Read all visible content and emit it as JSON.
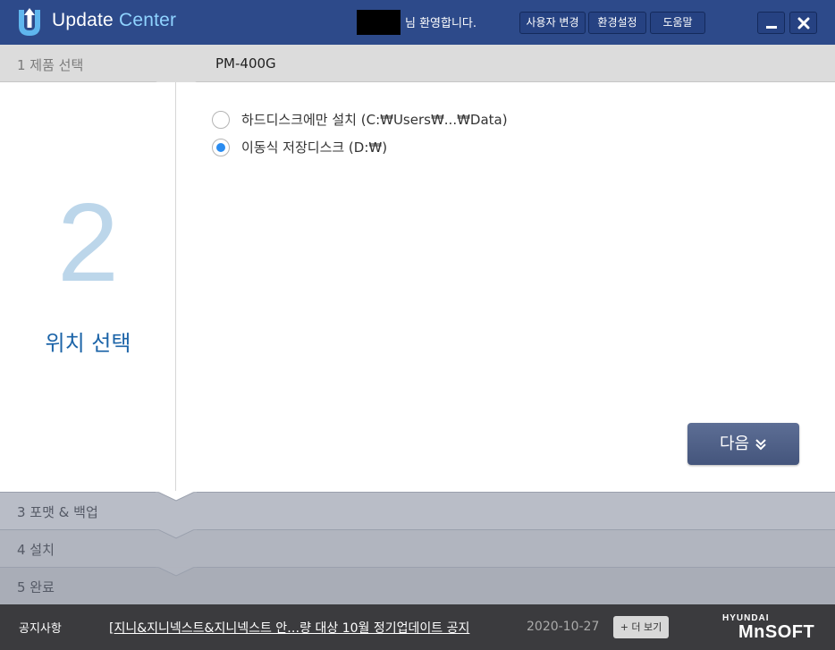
{
  "app": {
    "title_part1": "Update",
    "title_part2": "Center",
    "welcome": "님 환영합니다."
  },
  "header_buttons": {
    "change_user": "사용자 변경",
    "settings": "환경설정",
    "help": "도움말"
  },
  "steps": {
    "step1": {
      "label": "1  제품 선택",
      "value": "PM-400G"
    },
    "step2": {
      "number": "2",
      "title": "위치 선택"
    },
    "step3": {
      "label": "3  포맷 & 백업"
    },
    "step4": {
      "label": "4  설치"
    },
    "step5": {
      "label": "5  완료"
    }
  },
  "options": [
    {
      "label": "하드디스크에만 설치 (C:₩Users₩...₩Data)",
      "checked": false
    },
    {
      "label": "이동식 저장디스크 (D:₩)",
      "checked": true
    }
  ],
  "next_button": "다음",
  "footer": {
    "notice_label": "공지사항",
    "notice_text": "[지니&지니넥스트&지니넥스트  안…량 대상 10월 정기업데이트 공지",
    "notice_date": "2020-10-27",
    "more_button": "+ 더 보기",
    "brand_top": "HYUNDAI",
    "brand_bottom": "MnSOFT"
  },
  "colors": {
    "titlebar": "#2d4a8a",
    "accent": "#8fd3ff",
    "step_title": "#1c64a8",
    "big_number": "#bcd6ea",
    "radio_checked": "#2a8cf0",
    "footer": "#3b3b3e"
  }
}
